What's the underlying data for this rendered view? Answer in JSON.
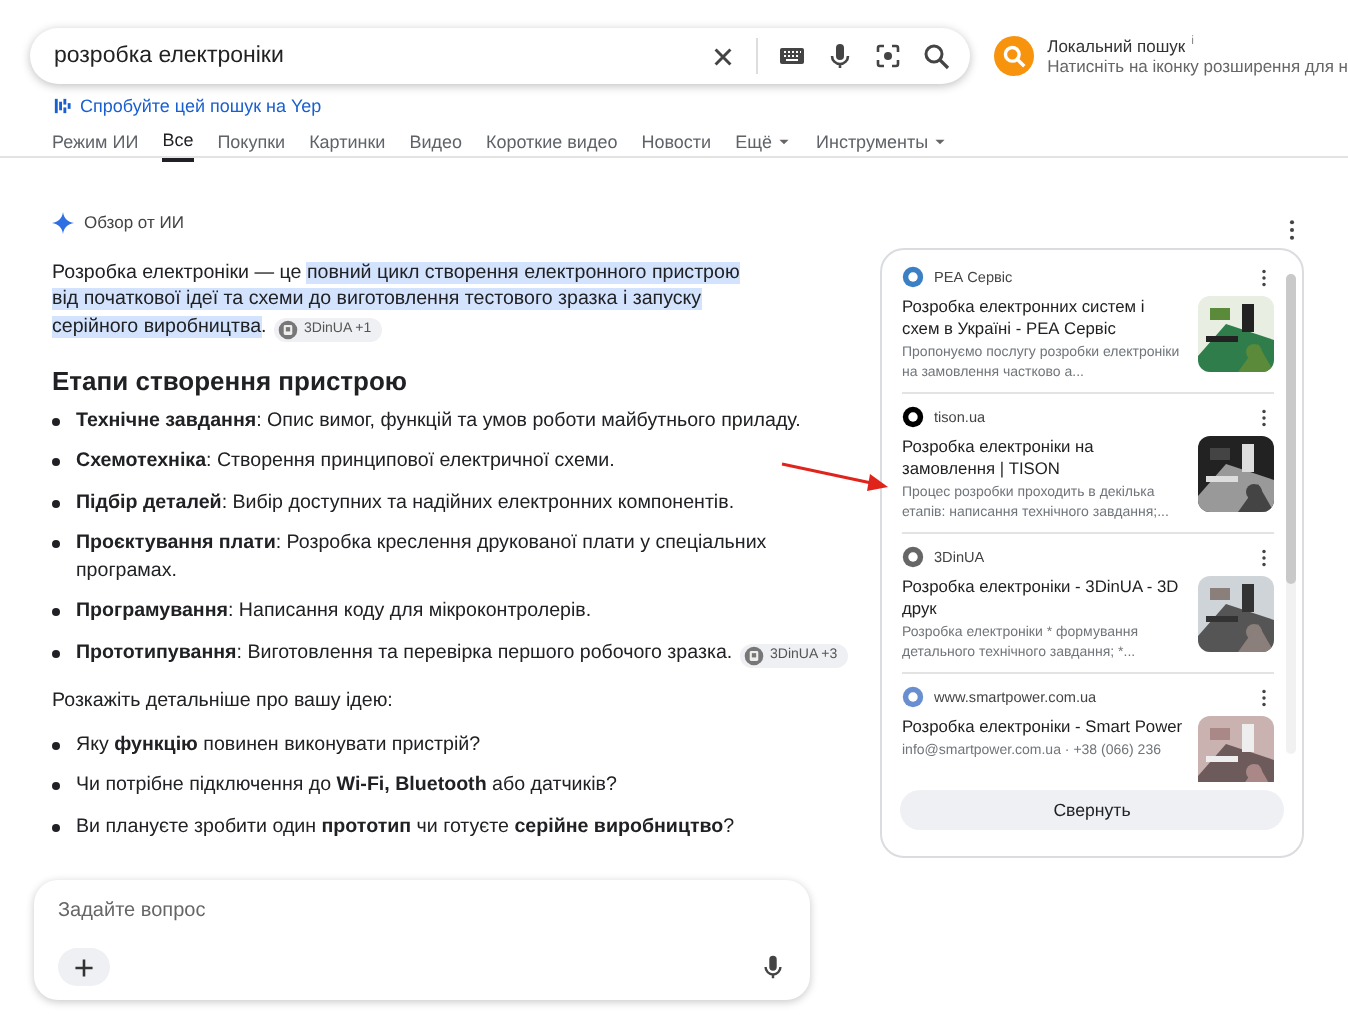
{
  "search": {
    "query": "розробка електроніки"
  },
  "local_search": {
    "title": "Локальний пошук",
    "mark": "i",
    "hint": "Натисніть на іконку розширення для н"
  },
  "yep_link": "Спробуйте цей пошук на Yep",
  "tabs": [
    {
      "label": "Режим ИИ",
      "selected": false,
      "kind": "plain"
    },
    {
      "label": "Все",
      "selected": true,
      "kind": "plain"
    },
    {
      "label": "Покупки",
      "selected": false,
      "kind": "plain"
    },
    {
      "label": "Картинки",
      "selected": false,
      "kind": "plain"
    },
    {
      "label": "Видео",
      "selected": false,
      "kind": "plain"
    },
    {
      "label": "Короткие видео",
      "selected": false,
      "kind": "plain"
    },
    {
      "label": "Новости",
      "selected": false,
      "kind": "plain"
    },
    {
      "label": "Ещё",
      "selected": false,
      "kind": "menu"
    },
    {
      "label": "Инструменты",
      "selected": false,
      "kind": "menu"
    }
  ],
  "ai_overview": {
    "title": "Обзор от ИИ",
    "intro": [
      {
        "text": "Розробка електроніки — це ",
        "highlighted": false
      },
      {
        "text": "повний цикл створення електронного пристрою від початкової ідеї та схеми до виготовлення тестового зразка і запуску серійного виробництва",
        "highlighted": true
      },
      {
        "text": ".",
        "highlighted": false
      }
    ],
    "intro_citation": "3DinUA +1",
    "heading": "Етапи створення пристрою",
    "stages": [
      {
        "text": "**Технічне завдання**: Опис вимог, функцій та умов роботи майбутнього приладу."
      },
      {
        "text": "**Схемотехніка**: Створення принципової електричної схеми."
      },
      {
        "text": "**Підбір деталей**: Вибір доступних та надійних електронних компонентів."
      },
      {
        "text": "**Проєктування плати**: Розробка креслення друкованої плати у спеціальних програмах."
      },
      {
        "text": "**Програмування**: Написання коду для мікроконтролерів."
      },
      {
        "text": "**Прототипування**: Виготовлення та перевірка першого робочого зразка.",
        "citation": "3DinUA +3"
      }
    ],
    "prompt": "Розкажіть детальніше про вашу ідею:",
    "questions": [
      "Яку **функцію** повинен виконувати пристрій?",
      "Чи потрібне підключення до **Wi-Fi, Bluetooth** або датчиків?",
      "Ви плануєте зробити один **прототип** чи готуєте **серійне виробництво**?"
    ]
  },
  "sources": {
    "items": [
      {
        "site": "РЕА Сервіс",
        "title": "Розробка електронних систем і схем в Україні - РЕА Сервіс",
        "snippet": "Пропонуємо послугу розробки електроніки на замовлення частково а...",
        "kind": "picture"
      },
      {
        "site": "tison.ua",
        "title": "Розробка електроніки на замовлення | TISON",
        "snippet": "Процес розробки проходить в декілька етапів: написання технічного завдання;...",
        "kind": "picture"
      },
      {
        "site": "3DinUA",
        "title": "Розробка електроніки - 3DinUA - 3D друк",
        "snippet": "Розробка електроніки * формування детального технічного завдання; *...",
        "kind": "picture"
      },
      {
        "site": "www.smartpower.com.ua",
        "title": "Розробка електроніки - Smart Power",
        "snippet": "info@smartpower.com.ua · +38 (066) 236",
        "kind": "picture"
      }
    ],
    "collapse_button": "Свернуть"
  },
  "chat": {
    "placeholder": "Задайте вопрос"
  }
}
